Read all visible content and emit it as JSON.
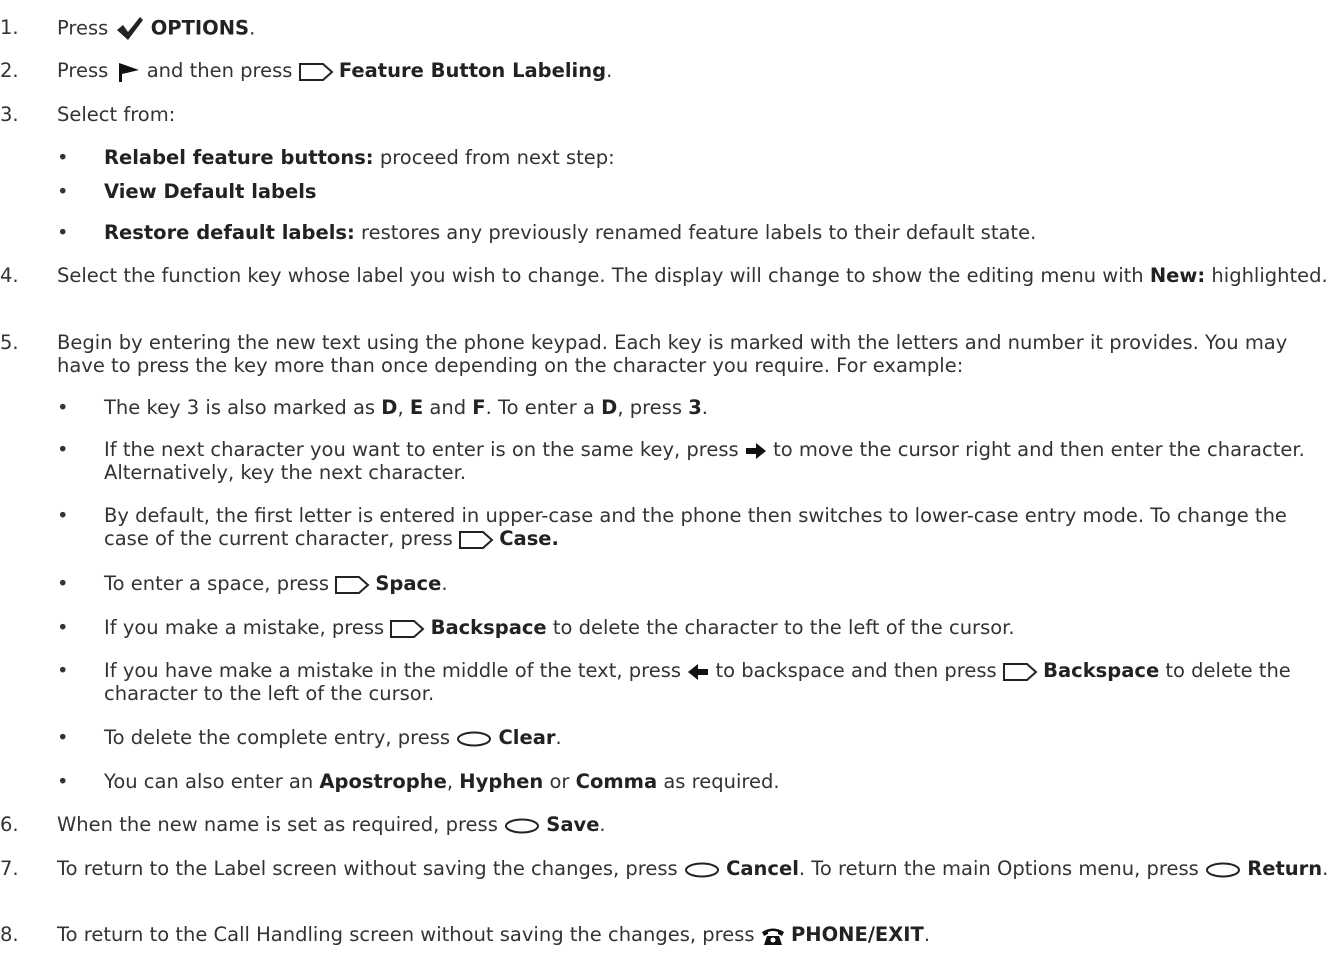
{
  "steps": [
    {
      "num": "1.",
      "t1": "Press",
      "b1": "OPTIONS",
      "t2": "."
    },
    {
      "num": "2.",
      "t1": "Press",
      "t2": "and then press",
      "b1": "Feature Button Labeling",
      "t3": "."
    },
    {
      "num": "3.",
      "t1": "Select from:"
    },
    {
      "num": "4.",
      "t1": "Select the function key whose label you wish to change. The display will change to show the editing menu with",
      "b1": "New:",
      "t2": "highlighted."
    },
    {
      "num": "5.",
      "t1": "Begin by entering the new text using the phone keypad. Each key is marked with the letters and number it provides. You may have to press the key more than once depending on the character you require. For example:"
    },
    {
      "num": "6.",
      "t1": "When the new name is set as required, press",
      "b1": "Save",
      "t2": "."
    },
    {
      "num": "7.",
      "t1": "To return to the Label screen without saving the changes, press",
      "b1": "Cancel",
      "t2": ". To return the main Options menu, press",
      "b2": "Return",
      "t3": "."
    },
    {
      "num": "8.",
      "t1": "To return to the Call Handling screen without saving the changes, press",
      "b1": "PHONE/EXIT",
      "t2": "."
    }
  ],
  "step3_bullets": [
    {
      "b": "Relabel feature buttons:",
      "t": "proceed from next step:"
    },
    {
      "b": "View Default labels",
      "t": ""
    },
    {
      "b": "Restore default labels:",
      "t": "restores any previously renamed feature labels to their default state."
    }
  ],
  "step5_bullets": {
    "b1": {
      "t1": "The key 3 is also marked as",
      "k1": "D",
      "s1": ",",
      "k2": "E",
      "s2": "and",
      "k3": "F",
      "s3": ". To enter a",
      "k4": "D",
      "s4": ", press",
      "k5": "3",
      "s5": "."
    },
    "b2": {
      "t1": "If the next character you want to enter is on the same key, press",
      "t2": "to move the cursor right and then enter the character. Alternatively, key the next character."
    },
    "b3": {
      "t1": "By default, the first letter is entered in upper-case and the phone then switches to lower-case entry mode. To change the case of the current character, press",
      "k1": "Case."
    },
    "b4": {
      "t1": "To enter a space, press",
      "k1": "Space",
      "t2": "."
    },
    "b5": {
      "t1": "If you make a mistake, press",
      "k1": "Backspace",
      "t2": "to delete the character to the left of the cursor."
    },
    "b6": {
      "t1": "If you have make a mistake in the middle of the text, press",
      "t2": "to backspace and then press",
      "k1": "Backspace",
      "t3": "to delete the character to the left of the cursor."
    },
    "b7": {
      "t1": "To delete the complete entry, press",
      "k1": "Clear",
      "t2": "."
    },
    "b8": {
      "t1": "You can also enter an",
      "k1": "Apostrophe",
      "s1": ",",
      "k2": "Hyphen",
      "s2": "or",
      "k3": "Comma",
      "s3": "as required."
    }
  },
  "bullet_char": "•",
  "icons": {
    "check": "check-icon",
    "page_arrow": "page-right-icon",
    "softkey_rect": "rectangular-soft-key-icon",
    "softkey_oval": "oval-soft-key-icon",
    "arrow_right": "right-arrow-icon",
    "arrow_left": "left-arrow-icon",
    "phone": "phone-icon"
  }
}
